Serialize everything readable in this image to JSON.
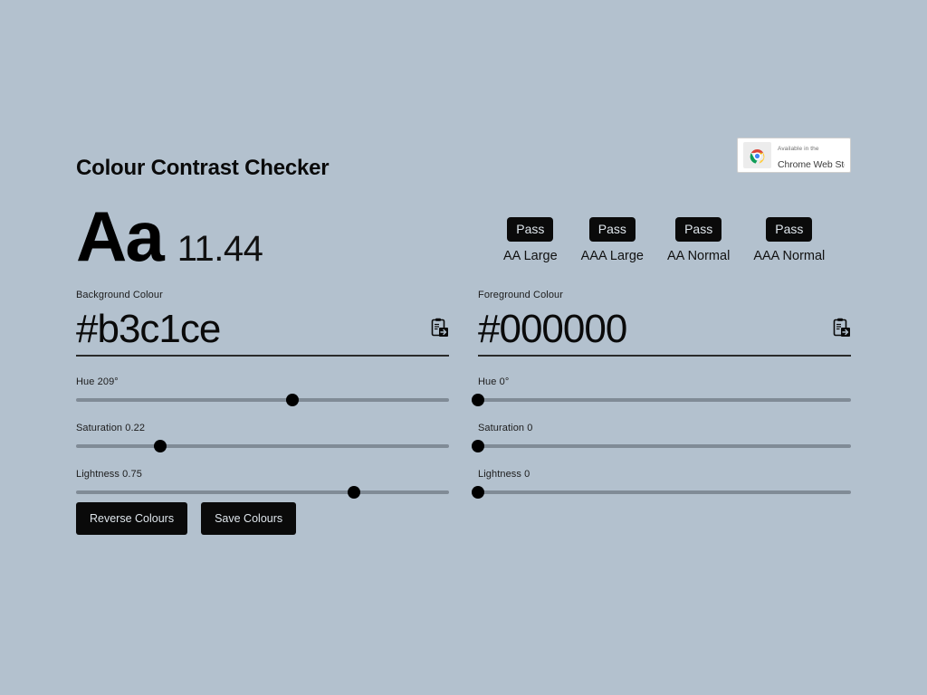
{
  "page": {
    "title": "Colour Contrast Checker",
    "background_colour": "#b3c1ce",
    "text_colour": "#000000"
  },
  "store_badge": {
    "line1": "Available in the",
    "line2": "Chrome Web Store"
  },
  "sample": {
    "text": "Aa",
    "contrast_ratio": "11.44"
  },
  "criteria": [
    {
      "result": "Pass",
      "label": "AA Large"
    },
    {
      "result": "Pass",
      "label": "AAA Large"
    },
    {
      "result": "Pass",
      "label": "AA Normal"
    },
    {
      "result": "Pass",
      "label": "AAA Normal"
    }
  ],
  "background": {
    "label": "Background Colour",
    "hex": "#b3c1ce",
    "placeholder": "#b3c1ce",
    "paste_icon": "clipboard-paste-icon",
    "sliders": [
      {
        "name": "hue",
        "label": "Hue 209°",
        "value": 209,
        "min": 0,
        "max": 360,
        "percent": 58
      },
      {
        "name": "saturation",
        "label": "Saturation 0.22",
        "value": 0.22,
        "min": 0,
        "max": 1,
        "percent": 22.5
      },
      {
        "name": "lightness",
        "label": "Lightness 0.75",
        "value": 0.75,
        "min": 0,
        "max": 1,
        "percent": 74.5
      }
    ]
  },
  "foreground": {
    "label": "Foreground Colour",
    "hex": "#000000",
    "placeholder": "#000000",
    "paste_icon": "clipboard-paste-icon",
    "sliders": [
      {
        "name": "hue",
        "label": "Hue 0°",
        "value": 0,
        "min": 0,
        "max": 360,
        "percent": 0
      },
      {
        "name": "saturation",
        "label": "Saturation 0",
        "value": 0,
        "min": 0,
        "max": 1,
        "percent": 0
      },
      {
        "name": "lightness",
        "label": "Lightness 0",
        "value": 0,
        "min": 0,
        "max": 1,
        "percent": 0
      }
    ]
  },
  "buttons": {
    "reverse": "Reverse Colours",
    "save": "Save Colours"
  }
}
